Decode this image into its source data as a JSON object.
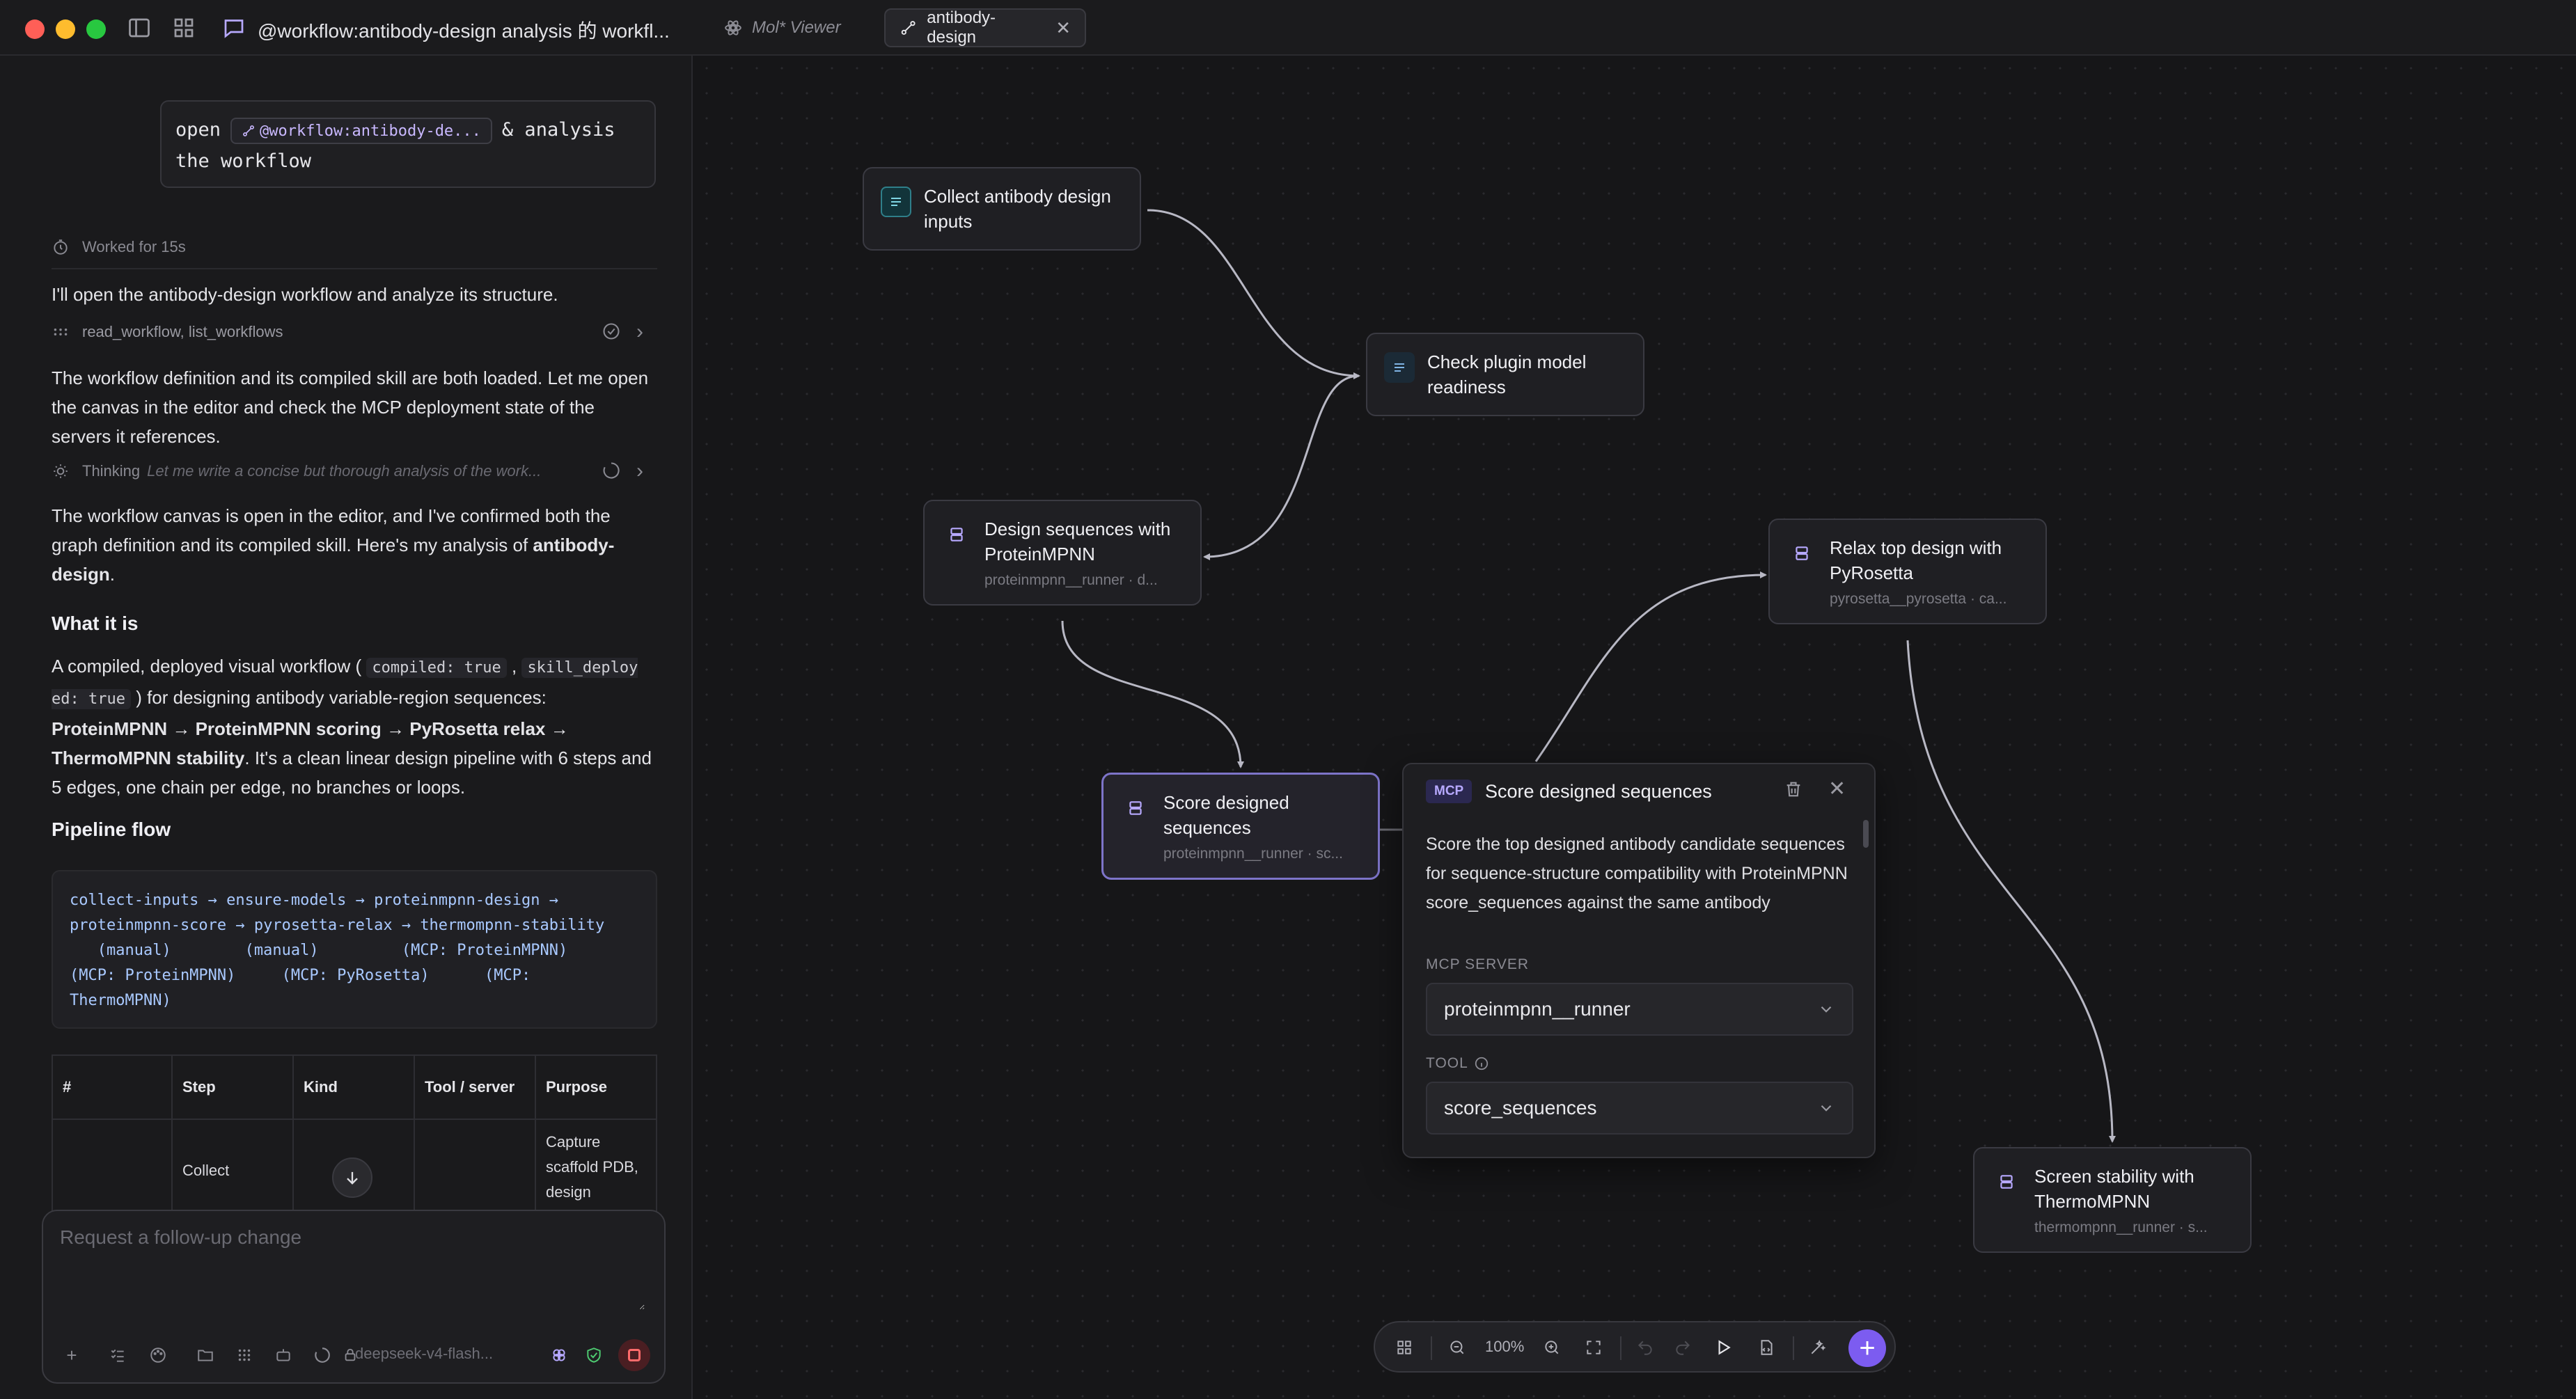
{
  "titlebar": {
    "chat_title": "@workflow:antibody-design analysis 的 workfl...",
    "tabs": [
      {
        "label": "Mol* Viewer"
      },
      {
        "label": "antibody-design"
      }
    ]
  },
  "sidebar": {
    "user_message": {
      "prefix": "open",
      "chip": "@workflow:antibody-de...",
      "suffix": "& analysis",
      "line2": "the workflow"
    },
    "worked_for": "Worked for 15s",
    "intro": "I'll open the antibody-design workflow and analyze its structure.",
    "tool_calls": "read_workflow, list_workflows",
    "p2": "The workflow definition and its compiled skill are both loaded. Let me open the canvas in the editor and check the MCP deployment state of the servers it references.",
    "thinking_label": "Thinking",
    "thinking_preview": "Let me write a concise but thorough analysis of the work...",
    "p3_a": "The workflow canvas is open in the editor, and I've confirmed both the graph definition and its compiled skill. Here's my analysis of ",
    "p3_b": "antibody-design",
    "p3_c": ".",
    "h_what": "What it is",
    "what_a": "A compiled, deployed visual workflow ( ",
    "what_code1": "compiled: true",
    "what_comma": " , ",
    "what_code2": "skill_deploy ed: true",
    "what_b": " ) for designing antibody variable-region sequences: ",
    "what_bold": "ProteinMPNN → ProteinMPNN scoring → PyRosetta relax → ThermoMPNN stability",
    "what_c": ". It's a clean linear design pipeline with 6 steps and 5 edges, one chain per edge, no branches or loops.",
    "h_flow": "Pipeline flow",
    "pipeline_code": "collect-inputs → ensure-models → proteinmpnn-design →\nproteinmpnn-score → pyrosetta-relax → thermompnn-stability\n   (manual)        (manual)         (MCP: ProteinMPNN)\n(MCP: ProteinMPNN)     (MCP: PyRosetta)      (MCP:\nThermoMPNN)",
    "table": {
      "headers": [
        "#",
        "Step",
        "Kind",
        "Tool / server",
        "Purpose"
      ],
      "row1": {
        "step": "Collect",
        "purpose": "Capture scaffold PDB, design"
      }
    },
    "composer": {
      "placeholder": "Request a follow-up change",
      "model": "deepseek-v4-flash..."
    }
  },
  "nodes": {
    "collect": {
      "title": "Collect antibody design inputs"
    },
    "check": {
      "title": "Check plugin model readiness"
    },
    "design": {
      "title": "Design sequences with ProteinMPNN",
      "sub": "proteinmpnn__runner · d..."
    },
    "score": {
      "title": "Score designed sequences",
      "sub": "proteinmpnn__runner · sc..."
    },
    "relax": {
      "title": "Relax top design with PyRosetta",
      "sub": "pyrosetta__pyrosetta · ca..."
    },
    "screen": {
      "title": "Screen stability with ThermoMPNN",
      "sub": "thermompnn__runner · s..."
    }
  },
  "panel": {
    "badge": "MCP",
    "title": "Score designed sequences",
    "description": "Score the top designed antibody candidate sequences for sequence-structure compatibility with ProteinMPNN score_sequences against the same antibody backbone PDB. Build a multi-",
    "server_label": "MCP SERVER",
    "server_value": "proteinmpnn__runner",
    "tool_label": "TOOL",
    "tool_value": "score_sequences"
  },
  "toolbar": {
    "zoom": "100%"
  },
  "colors": {
    "accent": "#7c5cf0",
    "node_border_selected": "#7d74c9",
    "edge": "#b8b8c4"
  }
}
